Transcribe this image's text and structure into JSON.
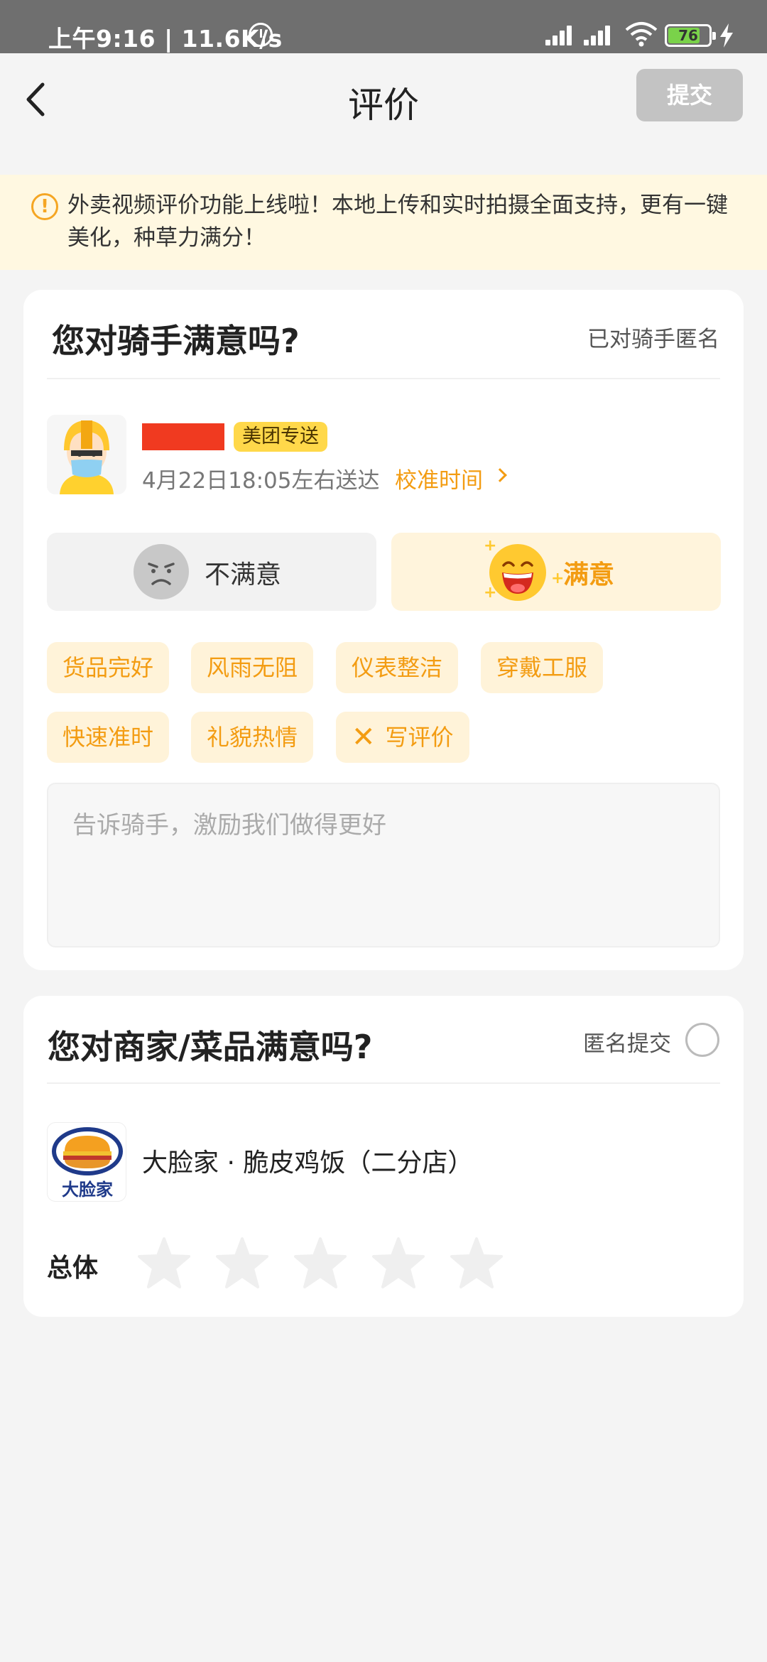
{
  "status_bar": {
    "time": "上午9:16 | 11.6K/s",
    "battery": "76"
  },
  "nav": {
    "title": "评价",
    "submit_label": "提交"
  },
  "notice": {
    "text": "外卖视频评价功能上线啦！本地上传和实时拍摄全面支持，更有一键美化，种草力满分！"
  },
  "rider_section": {
    "title": "您对骑手满意吗?",
    "anonymous_label": "已对骑手匿名",
    "delivery_tag": "美团专送",
    "eta_text": "4月22日18:05左右送达",
    "calibrate_link": "校准时间",
    "unsatisfied_label": "不满意",
    "satisfied_label": "满意",
    "tags": [
      "货品完好",
      "风雨无阻",
      "仪表整洁",
      "穿戴工服",
      "快速准时",
      "礼貌热情"
    ],
    "write_review_label": "写评价",
    "comment_placeholder": "告诉骑手，激励我们做得更好"
  },
  "merchant_section": {
    "title": "您对商家/菜品满意吗?",
    "anonymous_label": "匿名提交",
    "anonymous_checked": false,
    "store_name": "大脸家 · 脆皮鸡饭（二分店）",
    "store_logo_text": "大脸家",
    "overall_label": "总体",
    "rating": 0,
    "rating_max": 5
  },
  "colors": {
    "accent": "#f39c12",
    "tag_bg": "#fff3d9",
    "notice_bg": "#fff8e1",
    "submit_disabled": "#c3c3c3"
  }
}
